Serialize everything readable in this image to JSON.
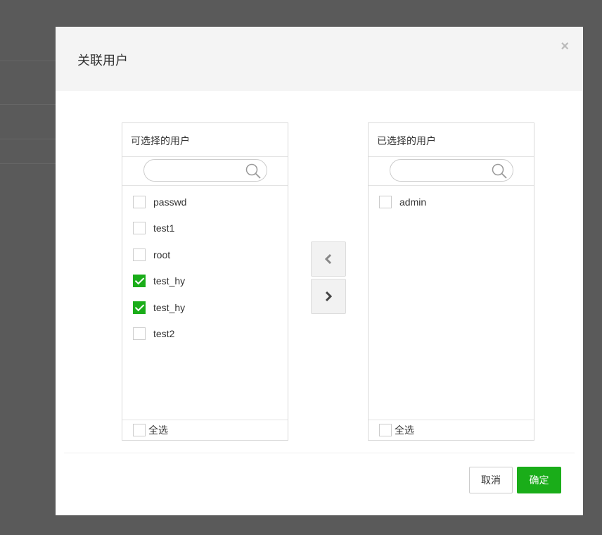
{
  "dialog": {
    "title": "关联用户",
    "close_label": "×"
  },
  "left_panel": {
    "title": "可选择的用户",
    "search_placeholder": "",
    "items": [
      {
        "label": "passwd",
        "checked": false
      },
      {
        "label": "test1",
        "checked": false
      },
      {
        "label": "root",
        "checked": false
      },
      {
        "label": "test_hy",
        "checked": true
      },
      {
        "label": "test_hy",
        "checked": true
      },
      {
        "label": "test2",
        "checked": false
      }
    ],
    "select_all_label": "全选"
  },
  "right_panel": {
    "title": "已选择的用户",
    "search_placeholder": "",
    "items": [
      {
        "label": "admin",
        "checked": false
      }
    ],
    "select_all_label": "全选"
  },
  "transfer": {
    "to_left_icon": "chevron-left-icon",
    "to_right_icon": "chevron-right-icon"
  },
  "footer": {
    "cancel_label": "取消",
    "ok_label": "确定"
  },
  "colors": {
    "accent": "#1aad19",
    "overlay": "#5a5a5a",
    "header_bg": "#f4f4f4"
  }
}
